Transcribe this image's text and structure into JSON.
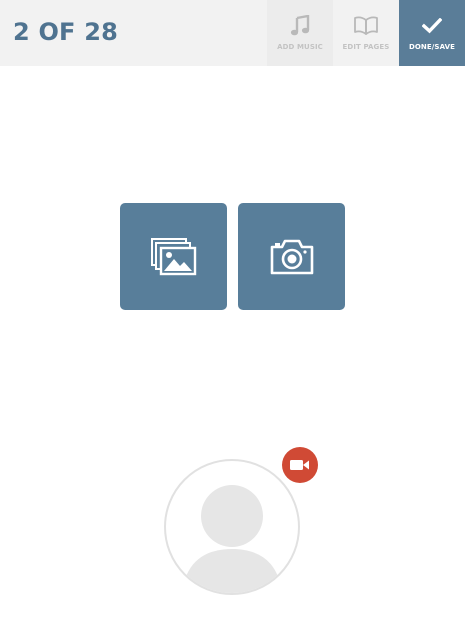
{
  "header": {
    "page_counter": "2 OF 28"
  },
  "toolbar": {
    "items": [
      {
        "label": "ADD MUSIC",
        "icon": "music-note-icon"
      },
      {
        "label": "EDIT PAGES",
        "icon": "open-book-icon"
      },
      {
        "label": "DONE/SAVE",
        "icon": "checkmark-icon"
      }
    ]
  },
  "media_buttons": [
    {
      "icon": "photo-gallery-icon"
    },
    {
      "icon": "camera-icon"
    }
  ],
  "narrator": {
    "avatar_icon": "person-placeholder-icon",
    "video_icon": "video-camera-icon"
  },
  "colors": {
    "accent": "#587e9a",
    "header_bg": "#f2f2f2",
    "counter_text": "#4f7390",
    "record_badge": "#d04a35",
    "avatar_gray": "#e6e6e6"
  }
}
